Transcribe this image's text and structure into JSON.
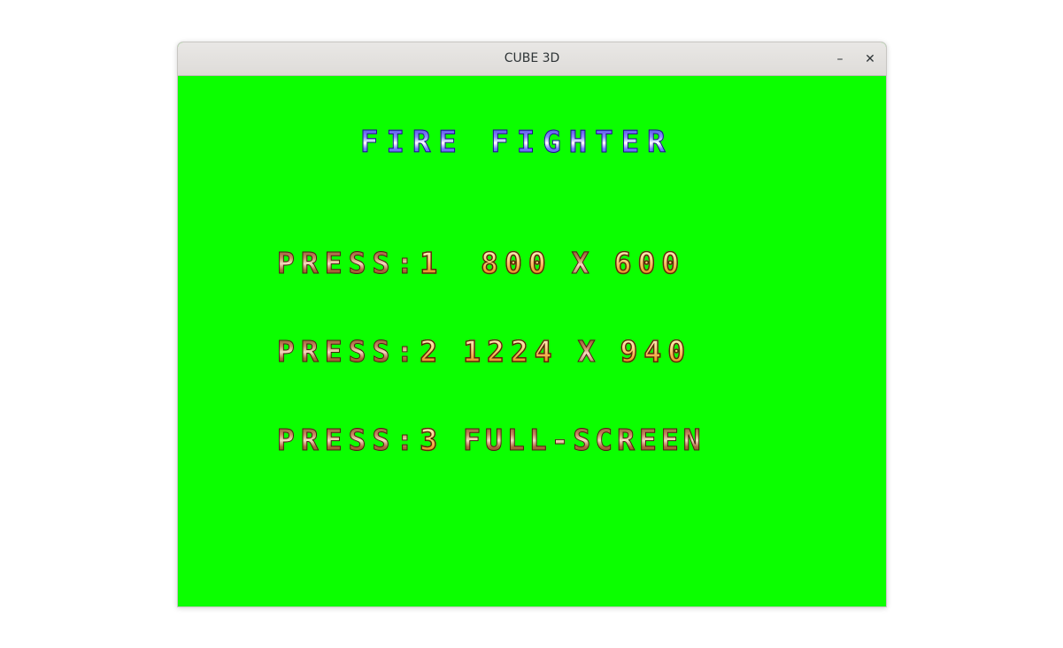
{
  "window": {
    "title": "CUBE 3D",
    "minimize_label": "–",
    "close_label": "✕"
  },
  "game": {
    "background_color": "#0bff00",
    "heading": "FIRE FIGHTER",
    "options": [
      {
        "press": "PRESS:",
        "key": "1",
        "left": "800",
        "sep": "X",
        "right": "600"
      },
      {
        "press": "PRESS:",
        "key": "2",
        "left": "1224",
        "sep": "X",
        "right": "940"
      },
      {
        "press": "PRESS:",
        "key": "3",
        "label": "FULL-SCREEN"
      }
    ]
  }
}
